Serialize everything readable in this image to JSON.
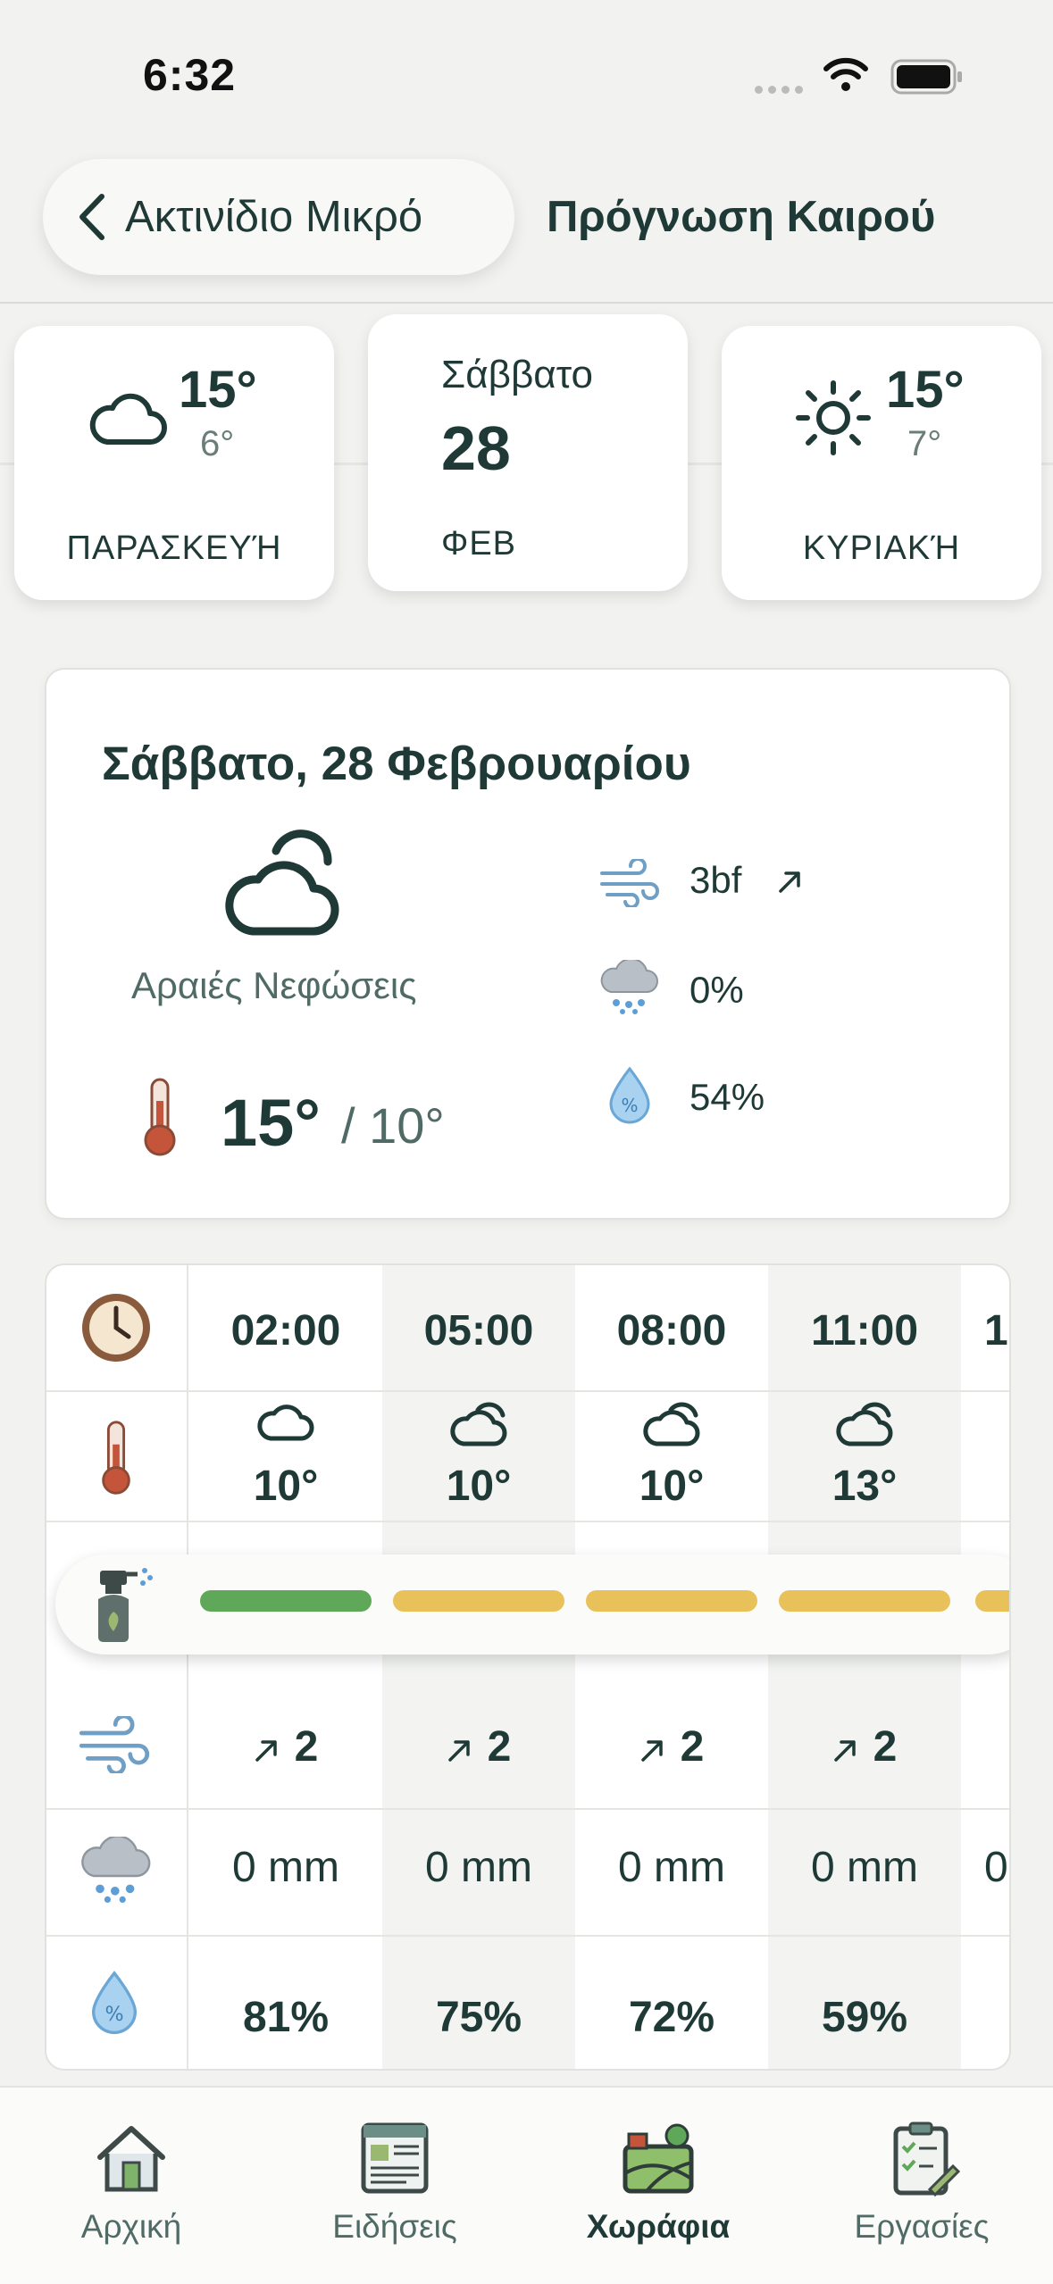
{
  "status_bar": {
    "time": "6:32"
  },
  "header": {
    "back_label": "Ακτινίδιο Μικρό",
    "title": "Πρόγνωση Καιρού"
  },
  "day_cards": [
    {
      "icon": "cloud-icon",
      "high": "15°",
      "low": "6°",
      "name": "ΠΑΡΑΣΚΕΥΉ"
    },
    {
      "weekday": "Σάββατο",
      "day": "28",
      "month": "ΦΕΒ"
    },
    {
      "icon": "sun-icon",
      "high": "15°",
      "low": "7°",
      "name": "ΚΥΡΙΑΚΉ"
    }
  ],
  "summary": {
    "date": "Σάββατο, 28 Φεβρουαρίου",
    "condition": "Αραιές Νεφώσεις",
    "high": "15°",
    "low": "/ 10°",
    "wind": "3bf",
    "rain": "0%",
    "humidity": "54%"
  },
  "hourly": {
    "hours": [
      "02:00",
      "05:00",
      "08:00",
      "11:00"
    ],
    "temps": [
      "10°",
      "10°",
      "10°",
      "13°"
    ],
    "spray_colors": [
      "#5fa85a",
      "#e8c15a",
      "#e8c15a",
      "#e8c15a"
    ],
    "wind": [
      "2",
      "2",
      "2",
      "2"
    ],
    "rain": [
      "0 mm",
      "0 mm",
      "0 mm",
      "0 mm"
    ],
    "humidity": [
      "81%",
      "75%",
      "72%",
      "59%"
    ]
  },
  "nav": {
    "items": [
      "Αρχική",
      "Ειδήσεις",
      "Χωράφια",
      "Εργασίες"
    ],
    "active": "Χωράφια"
  }
}
